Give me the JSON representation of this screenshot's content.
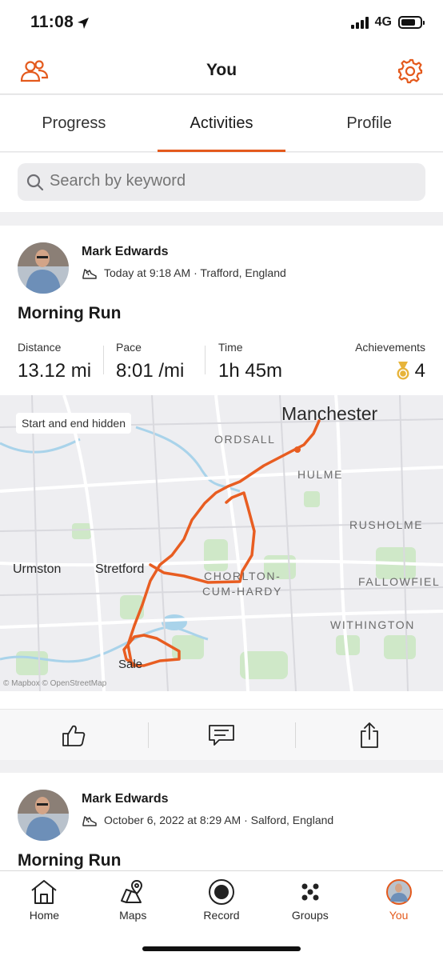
{
  "status_bar": {
    "time": "11:08",
    "network": "4G",
    "battery_level": 0.75,
    "signal_bars": 4
  },
  "header": {
    "title": "You",
    "friends_icon": "friends-icon",
    "settings_icon": "gear-icon"
  },
  "tabs": [
    {
      "label": "Progress",
      "active": false
    },
    {
      "label": "Activities",
      "active": true
    },
    {
      "label": "Profile",
      "active": false
    }
  ],
  "search": {
    "placeholder": "Search by keyword"
  },
  "activities": [
    {
      "athlete": "Mark Edwards",
      "meta": "Today at 9:18 AM · Trafford, England",
      "title": "Morning Run",
      "stats": {
        "distance_label": "Distance",
        "distance": "13.12 mi",
        "pace_label": "Pace",
        "pace": "8:01 /mi",
        "time_label": "Time",
        "time": "1h 45m",
        "achievements_label": "Achievements",
        "achievements": "4"
      },
      "map": {
        "badge": "Start and end hidden",
        "labels": {
          "manchester": "Manchester",
          "ordsall": "ORDSALL",
          "hulme": "HULME",
          "rusholme": "RUSHOLME",
          "urmston": "Urmston",
          "stretford": "Stretford",
          "chorlton1": "CHORLTON-",
          "chorlton2": "CUM-HARDY",
          "fallowfield": "FALLOWFIEL",
          "withington": "WITHINGTON",
          "sale": "Sale"
        },
        "attribution": "© Mapbox © OpenStreetMap",
        "route_color": "#e85d21"
      }
    },
    {
      "athlete": "Mark Edwards",
      "meta": "October 6, 2022 at 8:29 AM · Salford, England",
      "title": "Morning Run"
    }
  ],
  "bottom_nav": [
    {
      "label": "Home",
      "icon": "home-icon",
      "active": false
    },
    {
      "label": "Maps",
      "icon": "map-pin-icon",
      "active": false
    },
    {
      "label": "Record",
      "icon": "record-icon",
      "active": false
    },
    {
      "label": "Groups",
      "icon": "groups-icon",
      "active": false
    },
    {
      "label": "You",
      "icon": "avatar-icon",
      "active": true
    }
  ],
  "colors": {
    "accent": "#e45a1d",
    "route": "#e85d21",
    "medal": "#e7b43a"
  }
}
